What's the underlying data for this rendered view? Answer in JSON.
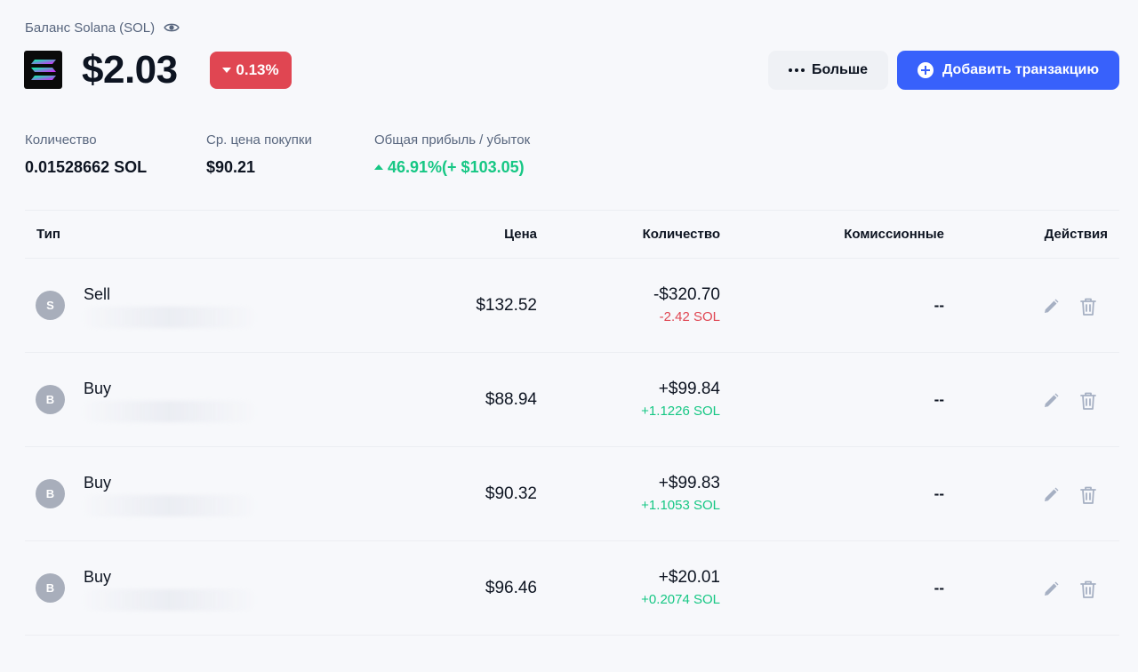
{
  "header": {
    "balance_label": "Баланс Solana (SOL)",
    "balance_value": "$2.03",
    "change": "0.13%",
    "more_label": "Больше",
    "add_label": "Добавить транзакцию"
  },
  "stats": {
    "quantity_label": "Количество",
    "quantity_value": "0.01528662 SOL",
    "avg_price_label": "Ср. цена покупки",
    "avg_price_value": "$90.21",
    "pnl_label": "Общая прибыль / убыток",
    "pnl_value": "46.91%(+ $103.05)"
  },
  "table": {
    "columns": {
      "type": "Тип",
      "price": "Цена",
      "quantity": "Количество",
      "fees": "Комиссионные",
      "actions": "Действия"
    },
    "rows": [
      {
        "initial": "S",
        "type": "Sell",
        "price": "$132.52",
        "usd": "-$320.70",
        "sol": "-2.42 SOL",
        "fee": "--"
      },
      {
        "initial": "B",
        "type": "Buy",
        "price": "$88.94",
        "usd": "+$99.84",
        "sol": "+1.1226 SOL",
        "fee": "--"
      },
      {
        "initial": "B",
        "type": "Buy",
        "price": "$90.32",
        "usd": "+$99.83",
        "sol": "+1.1053 SOL",
        "fee": "--"
      },
      {
        "initial": "B",
        "type": "Buy",
        "price": "$96.46",
        "usd": "+$20.01",
        "sol": "+0.2074 SOL",
        "fee": "--"
      }
    ]
  },
  "colors": {
    "accent": "#3861fb",
    "negative": "#e04652",
    "positive": "#16c784"
  }
}
